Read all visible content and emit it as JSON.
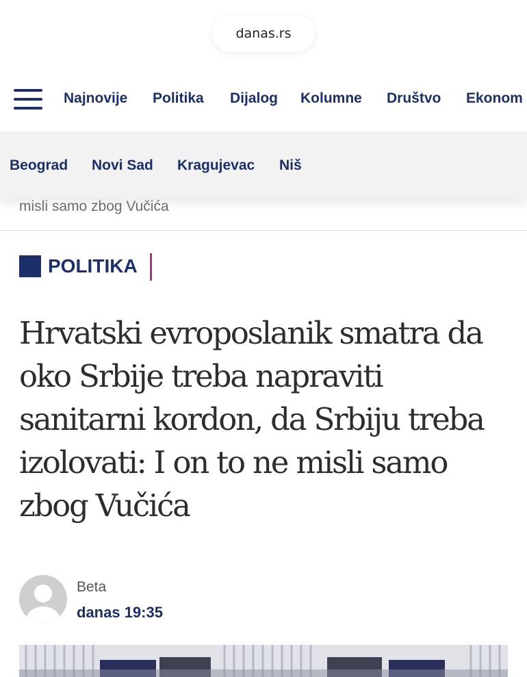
{
  "browser": {
    "url": "danas.rs"
  },
  "nav": {
    "menu_icon": "hamburger-menu-icon",
    "items": [
      "Najnovije",
      "Politika",
      "Dijalog",
      "Kolumne",
      "Društvo",
      "Ekonom"
    ]
  },
  "subnav": {
    "cities": [
      "Beograd",
      "Novi Sad",
      "Kragujevac",
      "Niš"
    ]
  },
  "breadcrumb": "misli samo zbog Vučića",
  "article": {
    "category": "POLITIKA",
    "headline": "Hrvatski evroposlanik smatra da oko Srbije treba napraviti sanitarni kordon, da Srbiju treba izolovati: I on to ne misli samo zbog Vučića",
    "author": "Beta",
    "time": "danas 19:35",
    "avatar_icon": "user-avatar-icon"
  },
  "colors": {
    "brand_navy": "#1c2f6b",
    "accent_magenta": "#a3338f",
    "subnav_bg": "#f2f2f2",
    "headline_text": "#2d2d2d"
  }
}
